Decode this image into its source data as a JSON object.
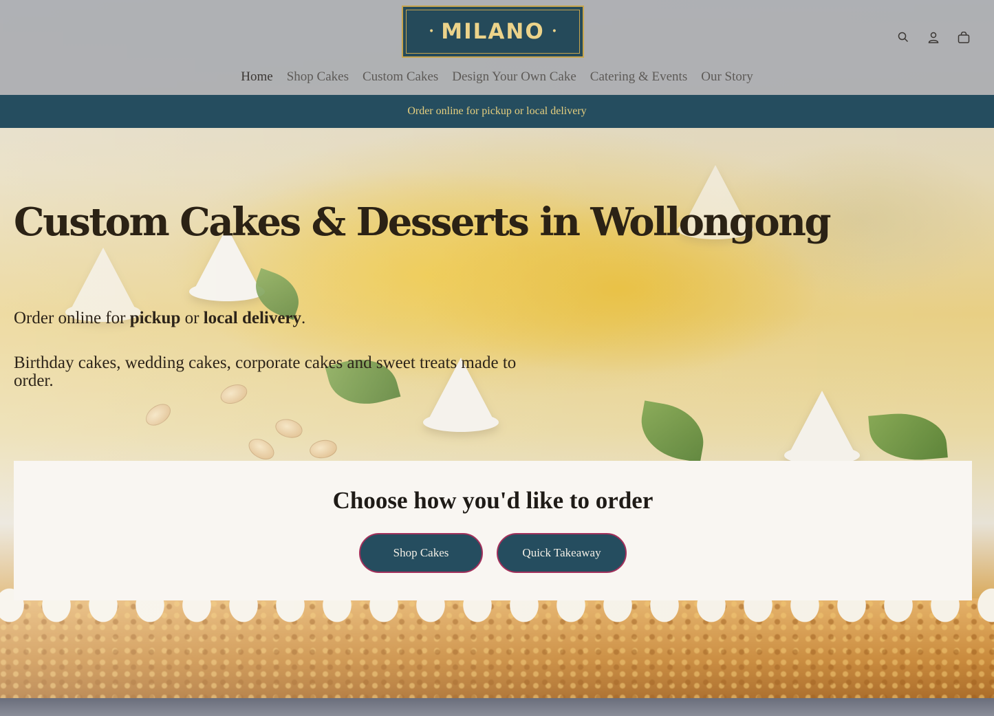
{
  "header": {
    "logo_text": "MILANO",
    "icons": [
      "search-icon",
      "account-icon",
      "cart-icon"
    ]
  },
  "nav": {
    "items": [
      {
        "label": "Home",
        "active": true
      },
      {
        "label": "Shop Cakes"
      },
      {
        "label": "Custom Cakes"
      },
      {
        "label": "Design Your Own Cake"
      },
      {
        "label": "Catering & Events"
      },
      {
        "label": "Our Story"
      }
    ]
  },
  "announcement": {
    "text": "Order online for pickup or local delivery"
  },
  "hero": {
    "title": "Custom Cakes & Desserts in Wollongong",
    "line1_prefix": "Order online for ",
    "line1_bold1": "pickup",
    "line1_mid": " or ",
    "line1_bold2": "local delivery",
    "line1_suffix": ".",
    "line2": "Birthday cakes, wedding cakes, corporate cakes and sweet treats made to order."
  },
  "order_card": {
    "title": "Choose how you'd like to order",
    "buttons": [
      {
        "label": "Shop Cakes"
      },
      {
        "label": "Quick Takeaway"
      }
    ]
  },
  "colors": {
    "brand_teal": "#254d5f",
    "brand_gold": "#e6cf7f",
    "button_border": "#a2305b",
    "card_bg": "#f9f6f2"
  }
}
